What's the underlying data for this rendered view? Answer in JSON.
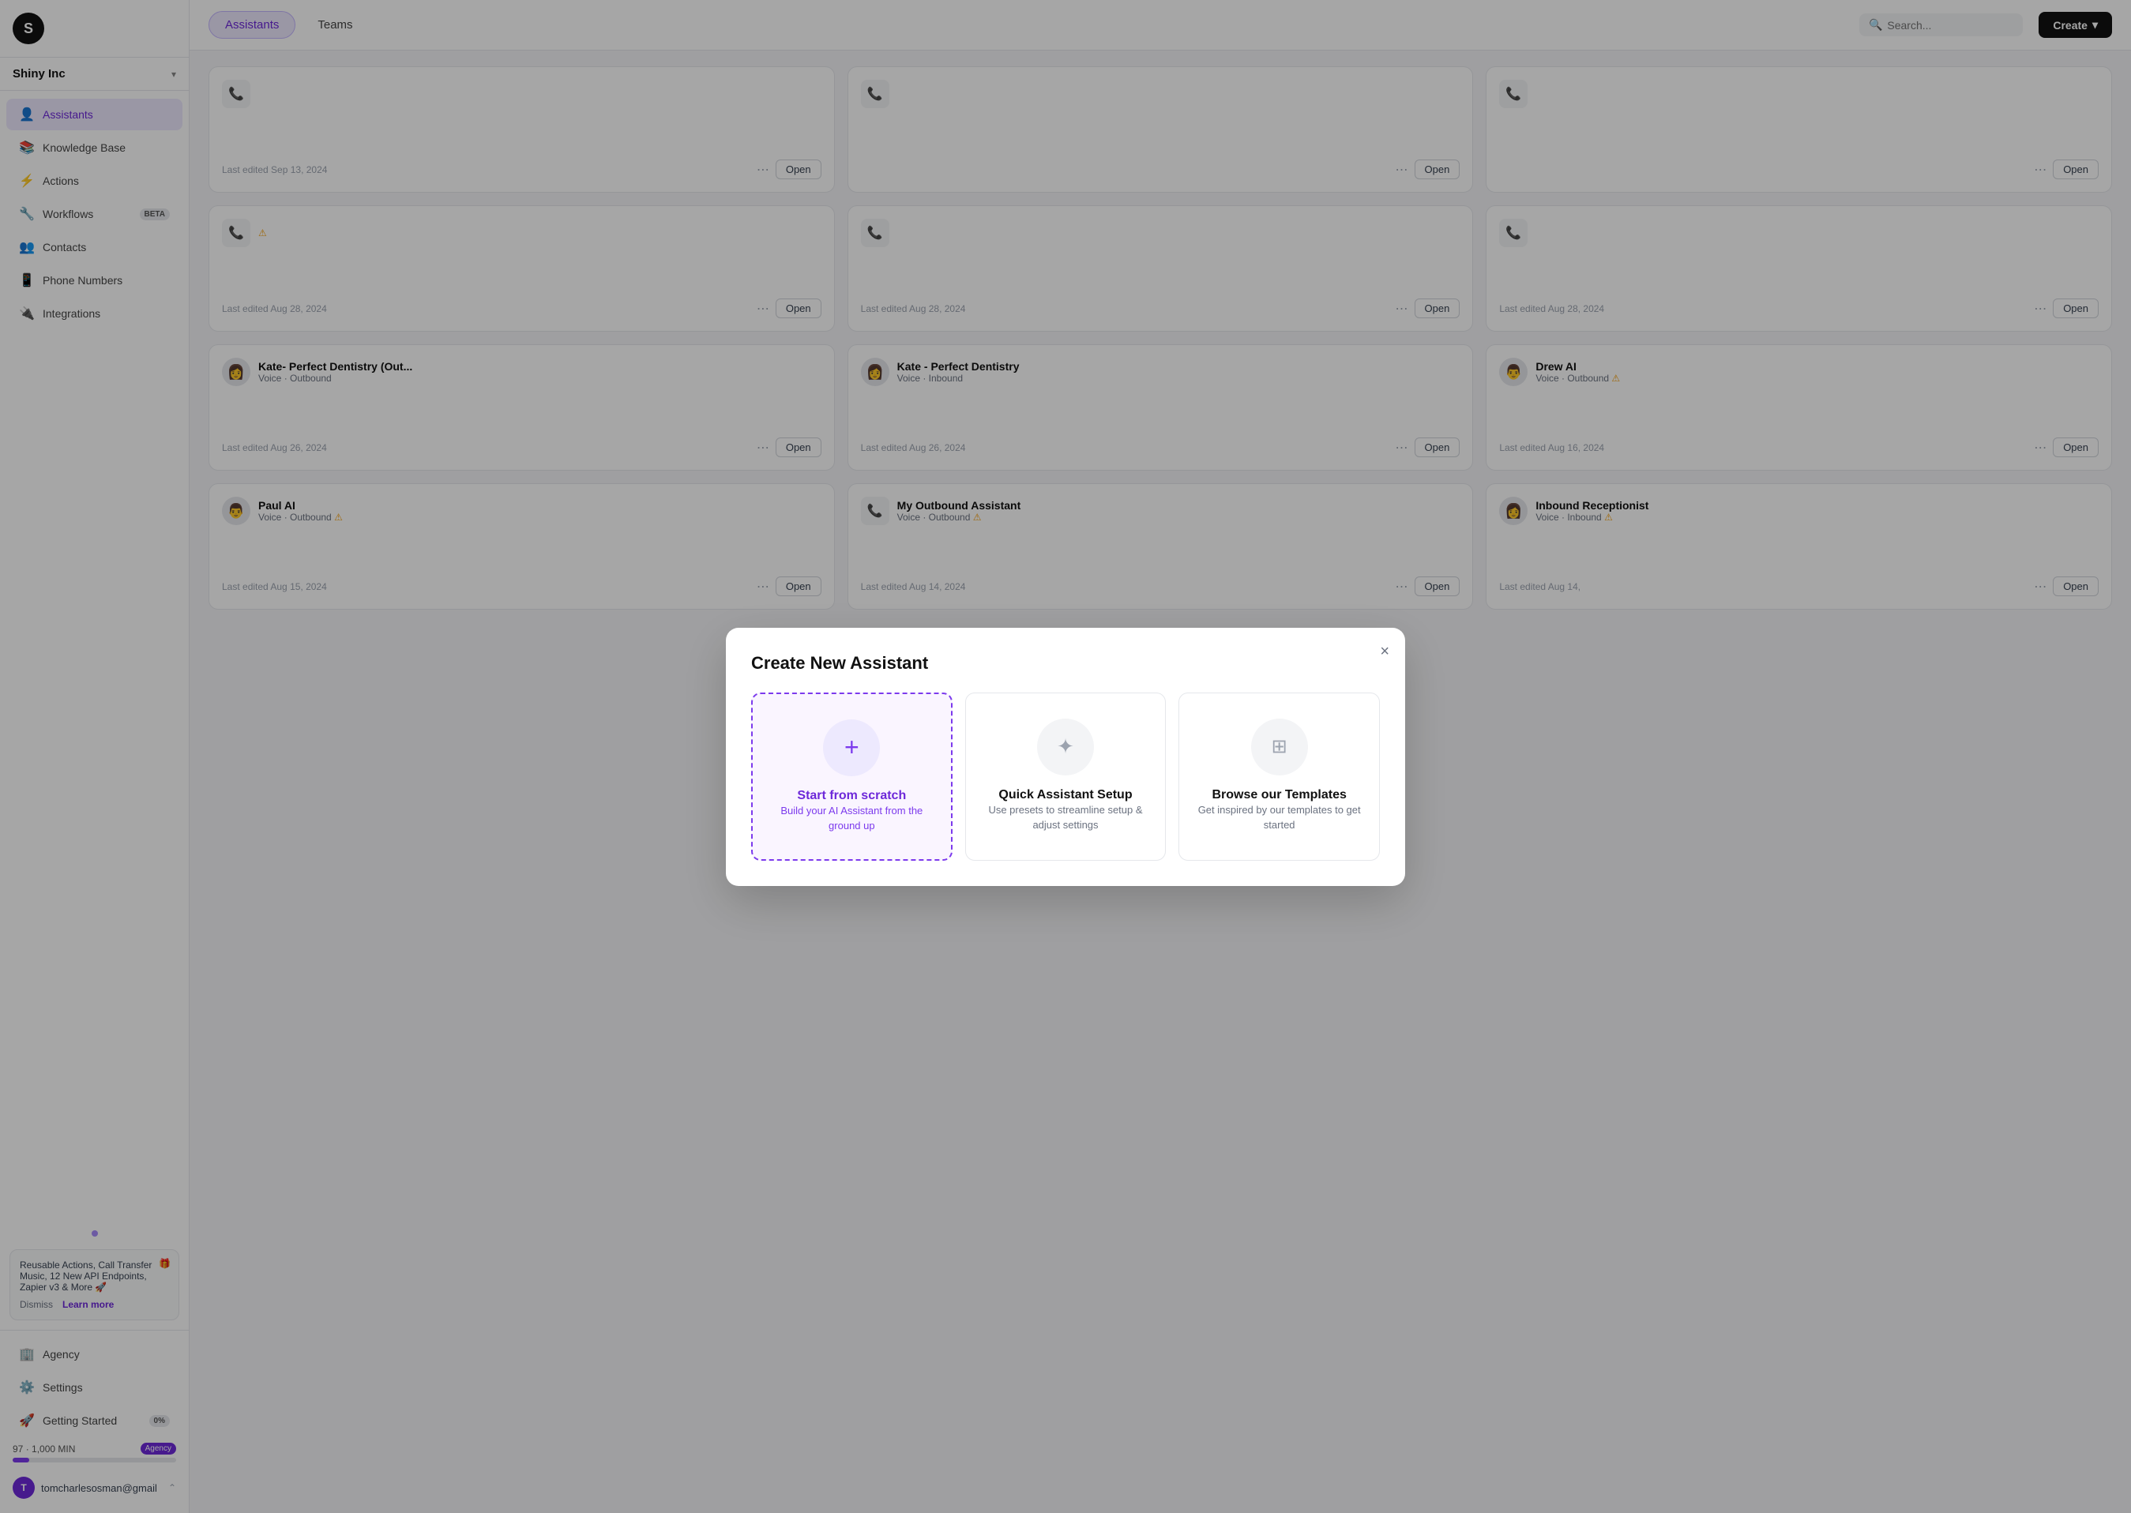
{
  "sidebar": {
    "logo_letter": "S",
    "org_name": "Shiny Inc",
    "nav_items": [
      {
        "id": "assistants",
        "label": "Assistants",
        "icon": "👤",
        "active": true
      },
      {
        "id": "knowledge-base",
        "label": "Knowledge Base",
        "icon": "📚",
        "active": false
      },
      {
        "id": "actions",
        "label": "Actions",
        "icon": "⚡",
        "active": false
      },
      {
        "id": "workflows",
        "label": "Workflows",
        "icon": "🔧",
        "active": false,
        "badge": "BETA"
      },
      {
        "id": "contacts",
        "label": "Contacts",
        "icon": "👥",
        "active": false
      },
      {
        "id": "phone-numbers",
        "label": "Phone Numbers",
        "icon": "📱",
        "active": false
      },
      {
        "id": "integrations",
        "label": "Integrations",
        "icon": "🔌",
        "active": false
      }
    ],
    "bottom_nav": [
      {
        "id": "agency",
        "label": "Agency",
        "icon": "🏢"
      },
      {
        "id": "settings",
        "label": "Settings",
        "icon": "⚙️"
      },
      {
        "id": "getting-started",
        "label": "Getting Started",
        "icon": "🚀",
        "badge": "0%"
      }
    ],
    "notification": {
      "text": "Reusable Actions, Call Transfer Music, 12 New API Endpoints, Zapier v3 & More 🚀",
      "dismiss_label": "Dismiss",
      "learn_label": "Learn more"
    },
    "usage": {
      "current": 97,
      "max": "1,000",
      "unit": "MIN",
      "badge": "Agency"
    },
    "user_email": "tomcharlesosman@gmail"
  },
  "topnav": {
    "tabs": [
      {
        "id": "assistants",
        "label": "Assistants",
        "active": true
      },
      {
        "id": "teams",
        "label": "Teams",
        "active": false
      }
    ],
    "search_placeholder": "Search...",
    "create_label": "Create"
  },
  "modal": {
    "title": "Create New Assistant",
    "close_label": "×",
    "options": [
      {
        "id": "scratch",
        "icon": "+",
        "title": "Start from scratch",
        "description": "Build your AI Assistant from the ground up",
        "selected": true
      },
      {
        "id": "quick",
        "icon": "✦",
        "title": "Quick Assistant Setup",
        "description": "Use presets to streamline setup & adjust settings",
        "selected": false
      },
      {
        "id": "templates",
        "icon": "⊞",
        "title": "Browse our Templates",
        "description": "Get inspired by our templates to get started",
        "selected": false
      }
    ]
  },
  "cards": [
    {
      "id": "card-1",
      "icon": "📞",
      "name": "",
      "type": "",
      "last_edited": "Last edited Sep 13, 2024",
      "open_label": "Open"
    },
    {
      "id": "card-2",
      "icon": "📞",
      "name": "",
      "type": "",
      "last_edited": "",
      "open_label": "Open"
    },
    {
      "id": "card-3",
      "icon": "📞",
      "name": "",
      "type": "",
      "last_edited": "",
      "open_label": "Open"
    },
    {
      "id": "card-4",
      "icon": "📞",
      "name": "",
      "type": "",
      "last_edited": "Last edited Aug 28, 2024",
      "open_label": "Open",
      "warning": true
    },
    {
      "id": "card-5",
      "icon": "📞",
      "name": "",
      "type": "",
      "last_edited": "Last edited Aug 28, 2024",
      "open_label": "Open"
    },
    {
      "id": "card-6",
      "icon": "📞",
      "name": "",
      "type": "",
      "last_edited": "Last edited Aug 28, 2024",
      "open_label": "Open"
    },
    {
      "id": "kate-out",
      "avatar": "👩",
      "name": "Kate- Perfect Dentistry (Out...",
      "type": "Voice · Outbound",
      "last_edited": "Last edited Aug 26, 2024",
      "open_label": "Open"
    },
    {
      "id": "kate-in",
      "avatar": "👩",
      "name": "Kate - Perfect Dentistry",
      "type": "Voice · Inbound",
      "last_edited": "Last edited Aug 26, 2024",
      "open_label": "Open"
    },
    {
      "id": "drew-ai",
      "avatar": "👨",
      "name": "Drew AI",
      "type": "Voice · Outbound",
      "type_warning": true,
      "last_edited": "Last edited Aug 16, 2024",
      "open_label": "Open"
    },
    {
      "id": "paul-ai",
      "avatar": "👨",
      "name": "Paul AI",
      "type": "Voice · Outbound",
      "type_warning": true,
      "last_edited": "Last edited Aug 15, 2024",
      "open_label": "Open"
    },
    {
      "id": "my-outbound",
      "icon": "📞",
      "name": "My Outbound Assistant",
      "type": "Voice · Outbound",
      "type_warning": true,
      "last_edited": "Last edited Aug 14, 2024",
      "open_label": "Open"
    },
    {
      "id": "inbound-receptionist",
      "avatar": "👩",
      "name": "Inbound Receptionist",
      "type": "Voice · Inbound",
      "type_warning": true,
      "last_edited": "Last edited Aug 14,",
      "open_label": "Open"
    }
  ]
}
